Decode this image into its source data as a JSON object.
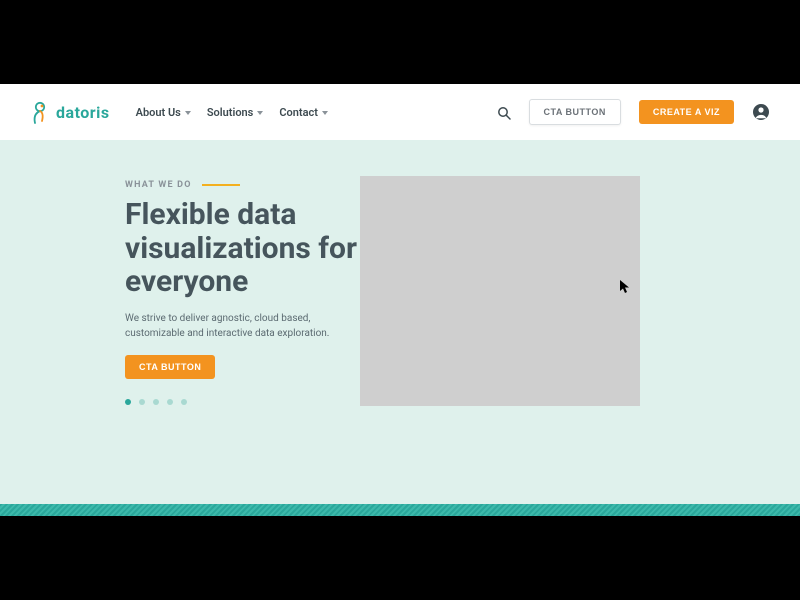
{
  "brand": {
    "name": "datoris"
  },
  "nav": {
    "items": [
      {
        "label": "About Us"
      },
      {
        "label": "Solutions"
      },
      {
        "label": "Contact"
      }
    ]
  },
  "header": {
    "cta_secondary": "CTA BUTTON",
    "cta_primary": "CREATE A VIZ"
  },
  "hero": {
    "eyebrow": "WHAT WE DO",
    "headline": "Flexible data visualizations for everyone",
    "subcopy": "We strive to deliver agnostic, cloud based, customizable and interactive data exploration.",
    "cta": "CTA BUTTON",
    "slide_count": 5,
    "active_slide": 0
  },
  "colors": {
    "accent_teal": "#2aa79b",
    "accent_orange": "#f3931f",
    "bg_mint": "#dff1ec"
  }
}
